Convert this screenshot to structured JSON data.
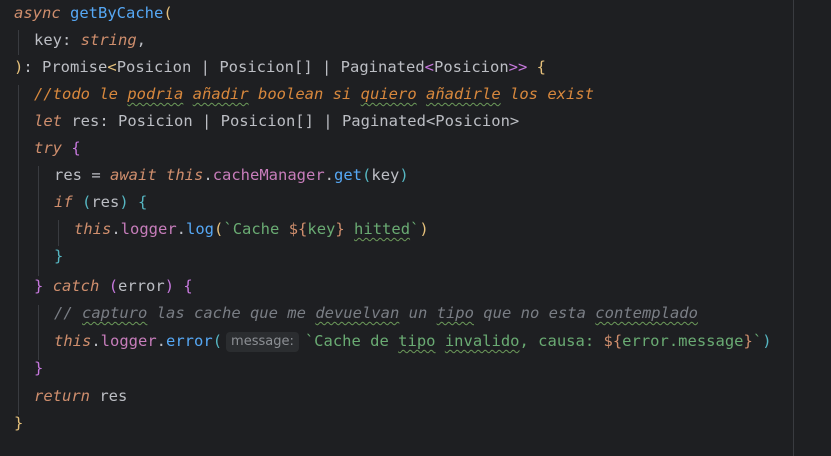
{
  "code": {
    "l1": {
      "async": "async",
      "name": "getByCache",
      "open": "("
    },
    "l2": {
      "param": "key",
      "colon": ": ",
      "type": "string",
      "comma": ","
    },
    "l3": {
      "close": ")",
      "sep": ": ",
      "t1": "Promise",
      "lt": "<",
      "t2": "Posicion",
      "pipe1": " | ",
      "t3": "Posicion[]",
      "pipe2": " | ",
      "t4": "Paginated",
      "lt2": "<",
      "t5": "Posicion",
      "gt": ">>",
      "brace": " {"
    },
    "l4": {
      "slashes": "//",
      "w1": "todo le ",
      "w2": "podria",
      "w3": " ",
      "w4": "añadir",
      "w5": " boolean si ",
      "w6": "quiero",
      "w7": " ",
      "w8": "añadirle",
      "w9": " los exist"
    },
    "l5": {
      "let": "let",
      "rest": " res: Posicion | Posicion[] | Paginated<Posicion>"
    },
    "l6": {
      "try": "try",
      "brace": " {"
    },
    "l7": {
      "res": "res = ",
      "await": "await",
      "this": "this",
      "dot": ".",
      "field": "cacheManager",
      "dot2": ".",
      "fn": "get",
      "open": "(",
      "arg": "key",
      "close": ")"
    },
    "l8": {
      "if": "if",
      "open": " (",
      "arg": "res",
      "close": ")",
      "brace": " {"
    },
    "l9": {
      "this": "this",
      "dot": ".",
      "field": "logger",
      "dot2": ".",
      "fn": "log",
      "open": "(",
      "s1": "`Cache ",
      "interp_open": "${",
      "var": "key",
      "interp_close": "}",
      "s2": " ",
      "s3": "hitted",
      "s4": "`",
      "close": ")"
    },
    "l10": {
      "brace": "}"
    },
    "l11": {
      "close": "}",
      "catch": "catch",
      "open": " (",
      "arg": "error",
      "close2": ")",
      "brace": " {"
    },
    "l12": {
      "c1": "// ",
      "c2": "capturo",
      "c3": " las cache que me ",
      "c4": "devuelvan",
      "c5": " un ",
      "c6": "tipo",
      "c7": " que no esta ",
      "c8": "contemplado"
    },
    "l13": {
      "this": "this",
      "dot": ".",
      "field": "logger",
      "dot2": ".",
      "fn": "error",
      "open": "(",
      "hint": "message:",
      "s1": "`Cache de ",
      "s2": "tipo",
      "s3": " ",
      "s4": "invalido",
      "s5": ", causa: ",
      "interp_open": "${",
      "var": "error.message",
      "interp_close": "}",
      "s6": "`",
      "close": ")"
    },
    "l14": {
      "brace": "}"
    },
    "l15": {
      "ret": "return",
      "var": " res"
    },
    "l16": {
      "brace": "}"
    }
  }
}
